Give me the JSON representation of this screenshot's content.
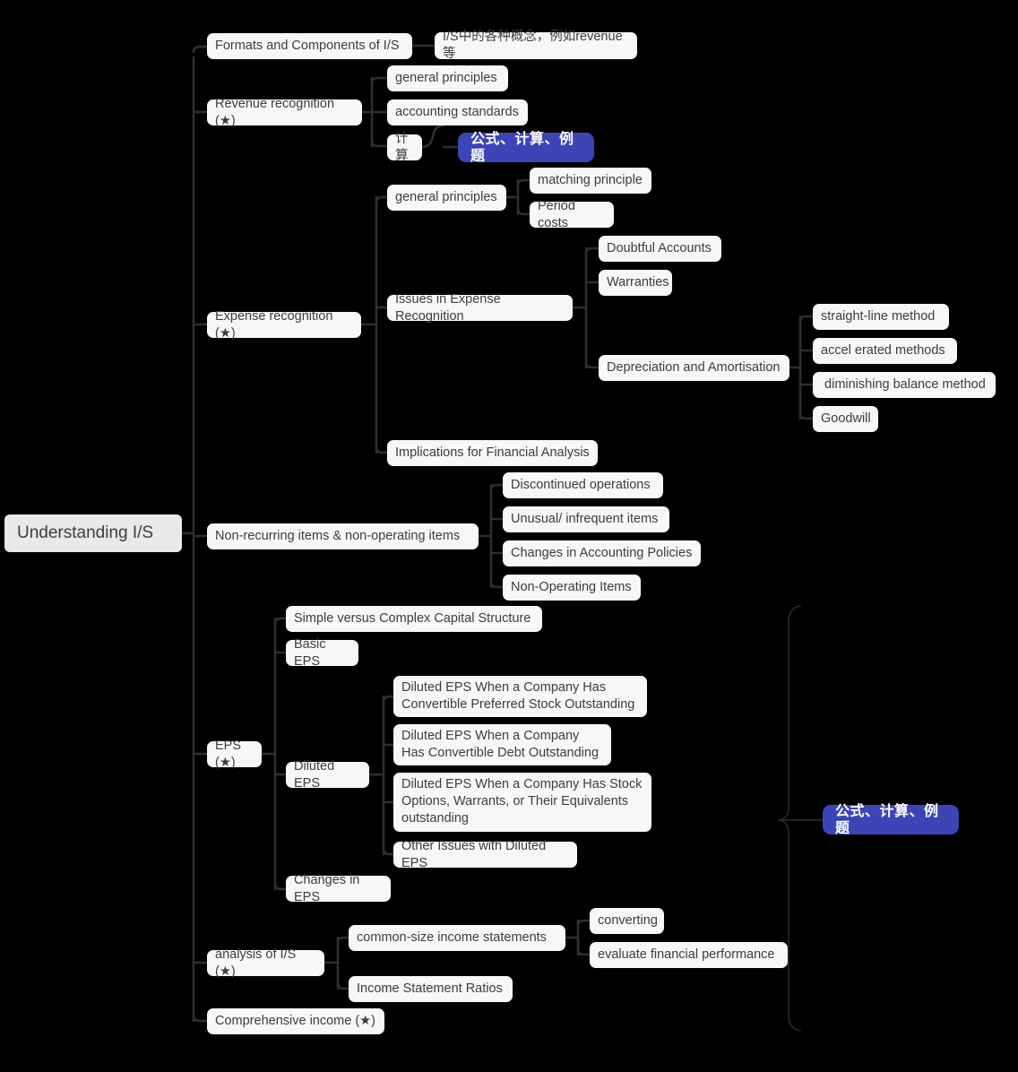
{
  "map": {
    "title": "Understanding I/S",
    "accent_color": "#3c45b5",
    "node_color": "#f7f7f7",
    "root_color": "#e9e9e9",
    "edge_color": "#2e2e2e",
    "background": "#000000"
  },
  "nodes": {
    "root": "Understanding I/S",
    "formats": "Formats and Components of I/S",
    "formats_child": "I/S中的各种概念，例如revenue等",
    "revenue": "Revenue recognition (★)",
    "rev_general": "general principles",
    "rev_standards": "accounting standards",
    "rev_calc": "计算",
    "accent_top": "公式、计算、例题",
    "expense": "Expense recognition (★)",
    "exp_general": "general principles",
    "exp_matching": "matching principle",
    "exp_period": "Period costs",
    "exp_issues": "Issues in Expense Recognition",
    "exp_doubtful": "Doubtful Accounts",
    "exp_warranties": "Warranties",
    "exp_depreciation": "Depreciation and Amortisation",
    "dep_straight": "straight-line method",
    "dep_accel": "accel erated methods",
    "dep_diminishing": " diminishing balance method",
    "dep_goodwill": "Goodwill",
    "exp_implications": "Implications for Financial Analysis",
    "nonrecurring": "Non-recurring items & non-operating items",
    "nr_discontinued": "Discontinued operations",
    "nr_unusual": "Unusual/ infrequent items",
    "nr_changes": "Changes in Accounting Policies",
    "nr_nonoperating": "Non-Operating Items",
    "eps": "EPS (★)",
    "eps_simple": "Simple versus Complex Capital Structure",
    "eps_basic": "Basic EPS",
    "eps_diluted": "Diluted EPS",
    "dil_preferred": "Diluted EPS When a Company Has Convertible Preferred Stock Outstanding",
    "dil_debt": "Diluted EPS When a Company Has Convertible Debt Outstanding",
    "dil_options": "Diluted EPS When a Company Has Stock Options, Warrants, or Their Equivalents outstanding",
    "dil_other": "Other Issues with Diluted EPS",
    "eps_changes": "Changes in EPS",
    "analysis": "analysis of I/S (★)",
    "an_commonsize": "common-size income statements",
    "an_converting": "converting",
    "an_evaluate": "evaluate financial performance",
    "an_ratios": "Income Statement Ratios",
    "comprehensive": "Comprehensive income (★)",
    "accent_bottom": "公式、计算、例题"
  }
}
